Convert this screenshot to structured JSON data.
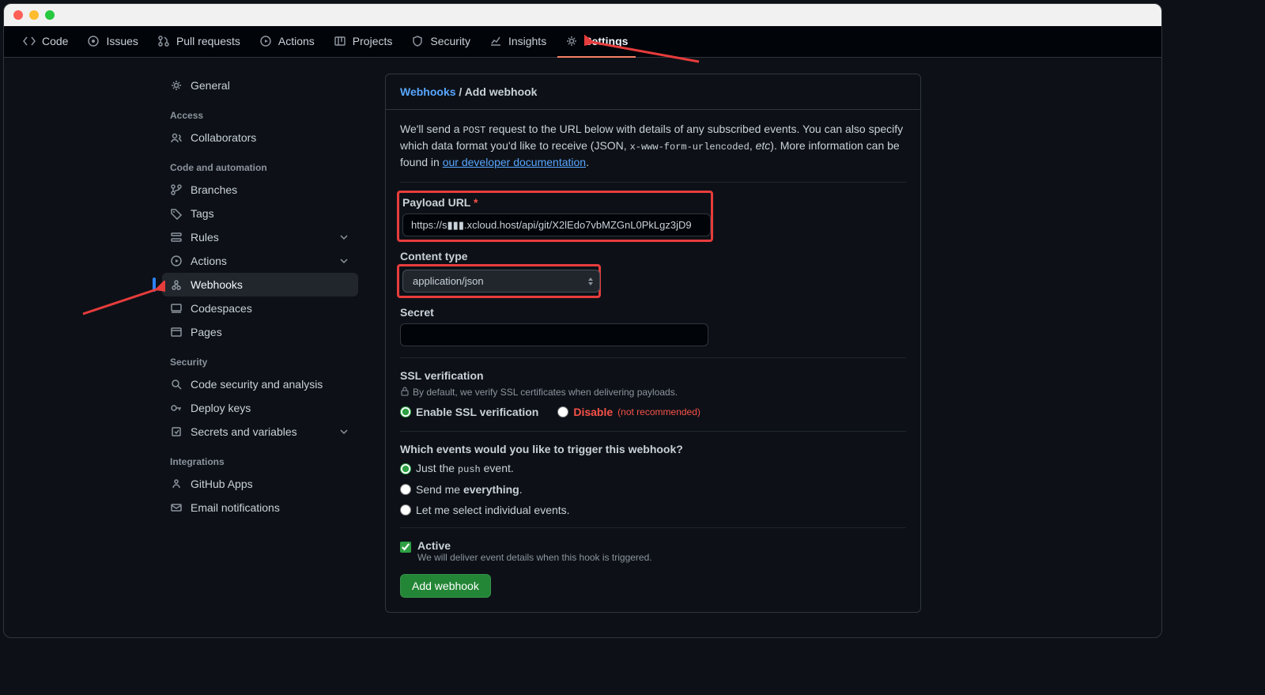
{
  "topnav": [
    {
      "id": "code",
      "label": "Code"
    },
    {
      "id": "issues",
      "label": "Issues"
    },
    {
      "id": "pull-requests",
      "label": "Pull requests"
    },
    {
      "id": "actions",
      "label": "Actions"
    },
    {
      "id": "projects",
      "label": "Projects"
    },
    {
      "id": "security",
      "label": "Security"
    },
    {
      "id": "insights",
      "label": "Insights"
    },
    {
      "id": "settings",
      "label": "Settings"
    }
  ],
  "sidebar": {
    "general": "General",
    "groups": {
      "access": "Access",
      "automation": "Code and automation",
      "security": "Security",
      "integrations": "Integrations"
    },
    "items": {
      "collaborators": "Collaborators",
      "branches": "Branches",
      "tags": "Tags",
      "rules": "Rules",
      "actions": "Actions",
      "webhooks": "Webhooks",
      "codespaces": "Codespaces",
      "pages": "Pages",
      "codesec": "Code security and analysis",
      "deploykeys": "Deploy keys",
      "secrets": "Secrets and variables",
      "ghapps": "GitHub Apps",
      "emailnotif": "Email notifications"
    }
  },
  "breadcrumb": {
    "root": "Webhooks",
    "sep": " / ",
    "leaf": "Add webhook"
  },
  "intro": {
    "p1a": "We'll send a ",
    "post": "POST",
    "p1b": " request to the URL below with details of any subscribed events. You can also specify which data format you'd like to receive (JSON, ",
    "enc": "x-www-form-urlencoded",
    "p1c": ", ",
    "etc": "etc",
    "p1d": "). More information can be found in ",
    "link": "our developer documentation",
    "p1e": "."
  },
  "form": {
    "payload_label": "Payload URL",
    "payload_value": "https://s▮▮▮.xcloud.host/api/git/X2lEdo7vbMZGnL0PkLgz3jD9",
    "content_label": "Content type",
    "content_value": "application/json",
    "secret_label": "Secret",
    "secret_value": "",
    "ssl_heading": "SSL verification",
    "ssl_note": "By default, we verify SSL certificates when delivering payloads.",
    "ssl_enable": "Enable SSL verification",
    "ssl_disable": "Disable",
    "ssl_disable_note": "(not recommended)",
    "events_q": "Which events would you like to trigger this webhook?",
    "ev_push_a": "Just the ",
    "ev_push_code": "push",
    "ev_push_b": " event.",
    "ev_all_a": "Send me ",
    "ev_all_b": "everything",
    "ev_all_c": ".",
    "ev_sel": "Let me select individual events.",
    "active_label": "Active",
    "active_desc": "We will deliver event details when this hook is triggered.",
    "submit": "Add webhook"
  }
}
